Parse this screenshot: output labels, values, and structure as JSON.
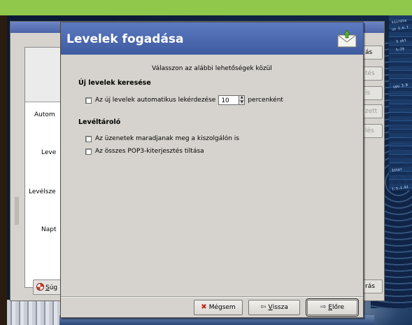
{
  "dialog": {
    "title": "Levelek fogadása",
    "instruction": "Válasszon az alábbi lehetőségek közül",
    "sections": {
      "new_mail": {
        "title": "Új levelek keresése",
        "auto_check_label": "Az új levelek automatikus lekérdezése",
        "interval_value": "10",
        "interval_suffix": "percenként"
      },
      "mailbox": {
        "title": "Levéltároló",
        "leave_on_server_label": "Az üzenetek maradjanak meg a kiszolgálón is",
        "disable_pop3_label": "Az összes POP3-kiterjesztés tiltása"
      }
    },
    "buttons": {
      "cancel": "Mégsem",
      "back_prefix": "",
      "back_mnemonic": "V",
      "back_rest": "issza",
      "forward_mnemonic": "E",
      "forward_rest": "lőre"
    }
  },
  "background_window": {
    "labels": [
      "Autom",
      "Leve",
      "Levélsze",
      "Napt"
    ],
    "side_buttons": [
      "ás",
      "tés",
      "ís",
      "zett",
      "lés"
    ],
    "bottom_right_button": "rás",
    "help_button_mnemonic": "S",
    "help_button_rest": "úg"
  },
  "desktop": {
    "labels": [
      "kiirata",
      "us 2.6.7",
      "3 okt",
      "5:29",
      "1.5.1.01",
      "Inter",
      "cpu 3.8"
    ]
  },
  "icons": {
    "dialog": "mail-envelope-icon",
    "cancel": "x-icon",
    "back": "arrow-left-icon",
    "forward": "arrow-right-icon",
    "help": "lifebuoy-icon"
  },
  "colors": {
    "header_blue": "#4a67ad",
    "dialog_bg": "#d6d3ce",
    "desktop_green": "#8fc84a",
    "cancel_icon_red": "#c0281d"
  }
}
